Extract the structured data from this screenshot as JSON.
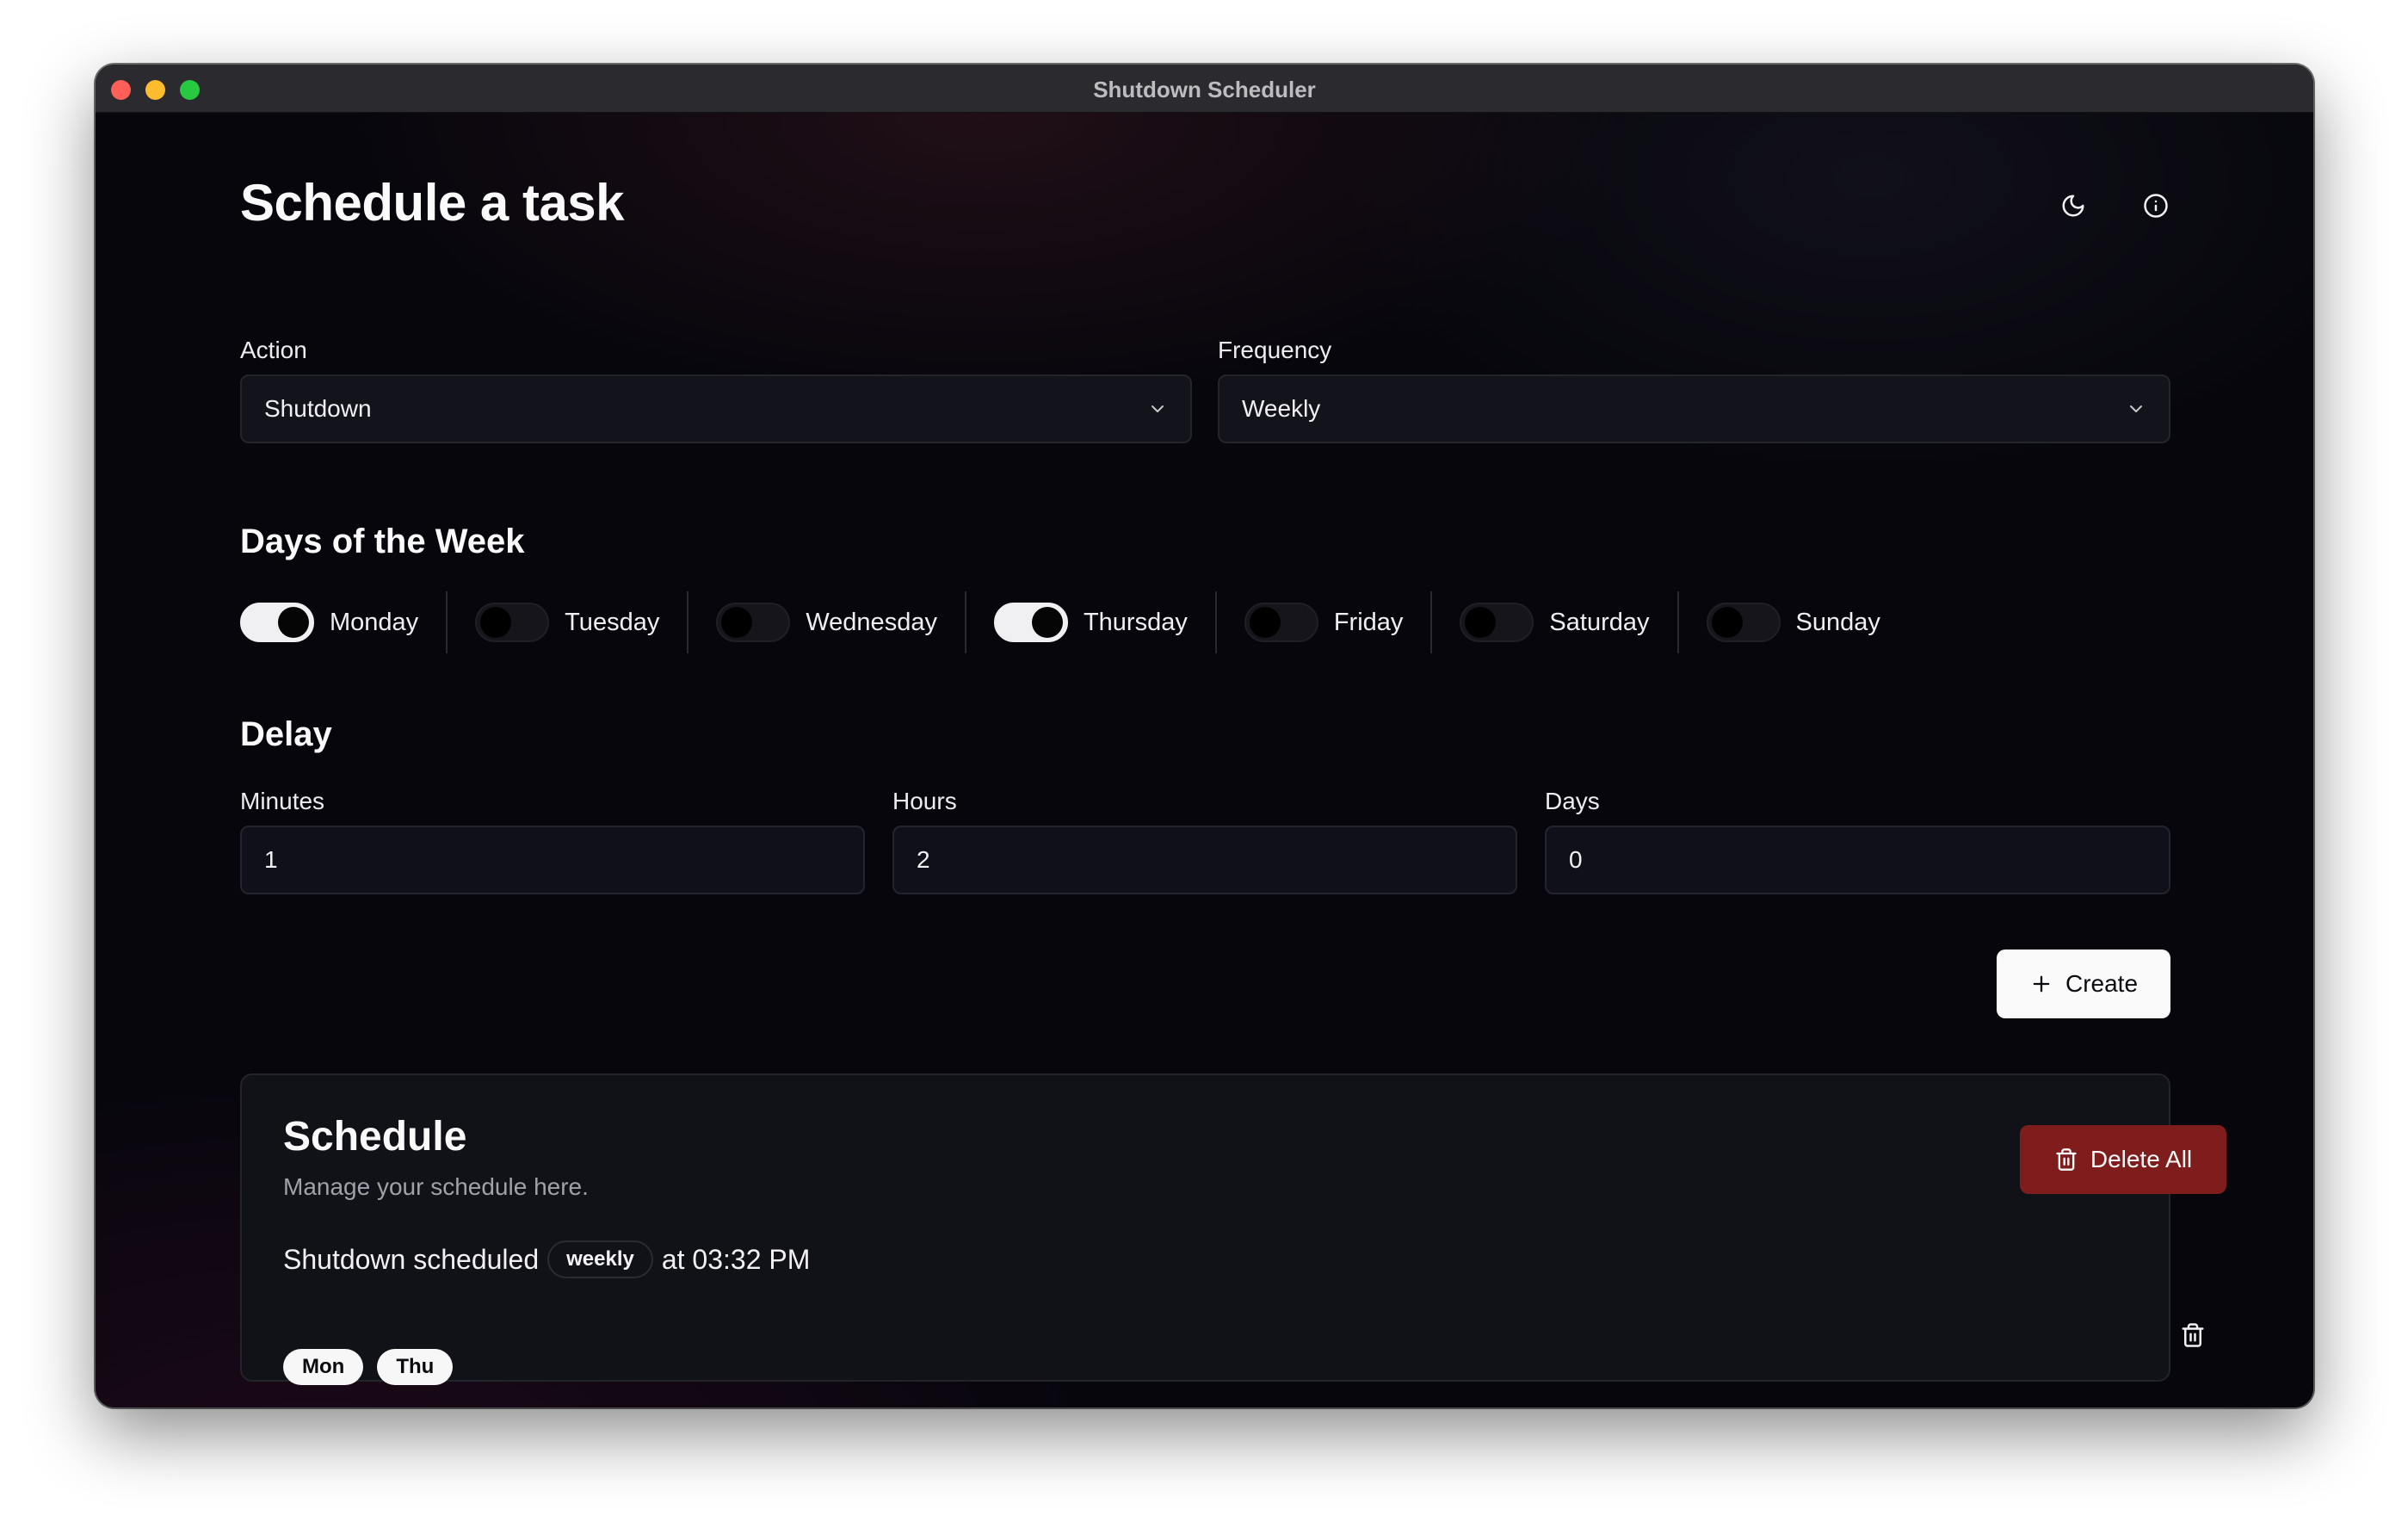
{
  "window": {
    "title": "Shutdown Scheduler"
  },
  "header": {
    "title": "Schedule a task",
    "theme_icon": "moon-icon",
    "info_icon": "info-icon"
  },
  "form": {
    "action": {
      "label": "Action",
      "value": "Shutdown"
    },
    "frequency": {
      "label": "Frequency",
      "value": "Weekly"
    }
  },
  "days_section": {
    "title": "Days of the Week",
    "days": [
      {
        "label": "Monday",
        "checked": true
      },
      {
        "label": "Tuesday",
        "checked": false
      },
      {
        "label": "Wednesday",
        "checked": false
      },
      {
        "label": "Thursday",
        "checked": true
      },
      {
        "label": "Friday",
        "checked": false
      },
      {
        "label": "Saturday",
        "checked": false
      },
      {
        "label": "Sunday",
        "checked": false
      }
    ]
  },
  "delay": {
    "title": "Delay",
    "minutes": {
      "label": "Minutes",
      "value": "1"
    },
    "hours": {
      "label": "Hours",
      "value": "2"
    },
    "days": {
      "label": "Days",
      "value": "0"
    }
  },
  "create_button": {
    "label": "Create"
  },
  "schedule": {
    "title": "Schedule",
    "subtitle": "Manage your schedule here.",
    "delete_all_label": "Delete All",
    "entries": [
      {
        "text": "Shutdown scheduled",
        "frequency": "weekly",
        "time_text": "at 03:32 PM",
        "days": [
          "Mon",
          "Thu"
        ]
      }
    ]
  },
  "colors": {
    "danger": "#7f1d1d",
    "accent": "#fafafa",
    "background": "#06060c"
  }
}
